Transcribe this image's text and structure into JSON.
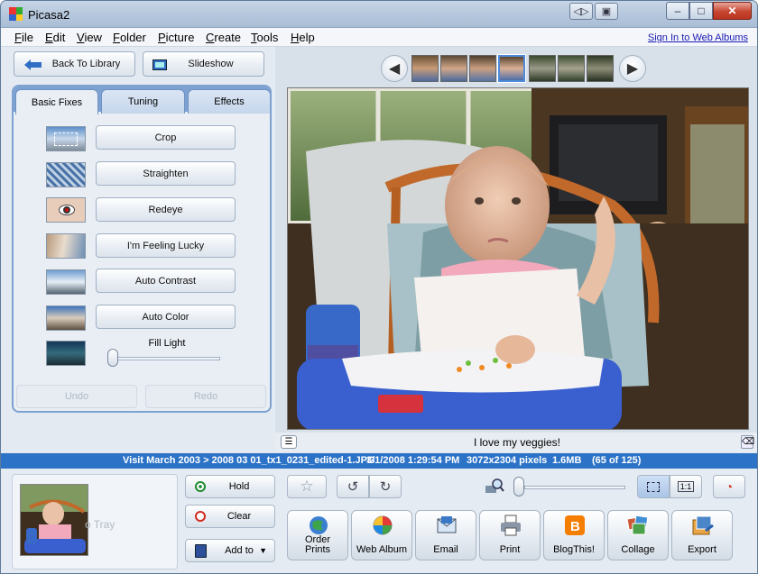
{
  "window": {
    "title": "Picasa2",
    "icon": "picasa-logo-icon",
    "min_label": "‒",
    "max_label": "□",
    "close_label": "✕",
    "mini1": "◁▷",
    "mini2": "▣"
  },
  "menu": {
    "items": [
      {
        "label": "File"
      },
      {
        "label": "Edit"
      },
      {
        "label": "View"
      },
      {
        "label": "Folder"
      },
      {
        "label": "Picture"
      },
      {
        "label": "Create"
      },
      {
        "label": "Tools"
      },
      {
        "label": "Help"
      }
    ],
    "sign_in": "Sign In to Web Albums"
  },
  "nav": {
    "back_label": "Back To Library",
    "slideshow_label": "Slideshow"
  },
  "tabs": [
    {
      "label": "Basic Fixes"
    },
    {
      "label": "Tuning"
    },
    {
      "label": "Effects"
    }
  ],
  "fixes": [
    {
      "label": "Crop",
      "icon": "crop-icon"
    },
    {
      "label": "Straighten",
      "icon": "straighten-icon"
    },
    {
      "label": "Redeye",
      "icon": "redeye-icon"
    },
    {
      "label": "I'm Feeling Lucky",
      "icon": "lucky-icon"
    },
    {
      "label": "Auto Contrast",
      "icon": "contrast-icon"
    },
    {
      "label": "Auto Color",
      "icon": "color-icon"
    }
  ],
  "fill_light": {
    "label": "Fill Light",
    "value": 0
  },
  "history": {
    "undo_label": "Undo",
    "redo_label": "Redo"
  },
  "filmstrip": {
    "count": 7,
    "selected_index": 3
  },
  "caption": "I love my veggies!",
  "status": {
    "path": "Visit March 2003 > 2008 03 01_tx1_0231_edited-1.JPG",
    "date": "3/1/2008 1:29:54 PM",
    "dimensions": "3072x2304 pixels",
    "size": "1.6MB",
    "position": "(65 of 125)"
  },
  "tray": {
    "label": "o Tray",
    "hold_label": "Hold",
    "clear_label": "Clear",
    "add_label": "Add to"
  },
  "actions": [
    {
      "label": "Order Prints",
      "icon": "globe-prints-icon"
    },
    {
      "label": "Web Album",
      "icon": "web-album-icon"
    },
    {
      "label": "Email",
      "icon": "email-icon"
    },
    {
      "label": "Print",
      "icon": "printer-icon"
    },
    {
      "label": "BlogThis!",
      "icon": "blogger-icon"
    },
    {
      "label": "Collage",
      "icon": "collage-icon"
    },
    {
      "label": "Export",
      "icon": "export-icon"
    }
  ],
  "view": {
    "actual_size_label": "1:1"
  },
  "colors": {
    "accent": "#2c73c7",
    "tab_border": "#7da1d1",
    "blogger": "#f57d00"
  }
}
